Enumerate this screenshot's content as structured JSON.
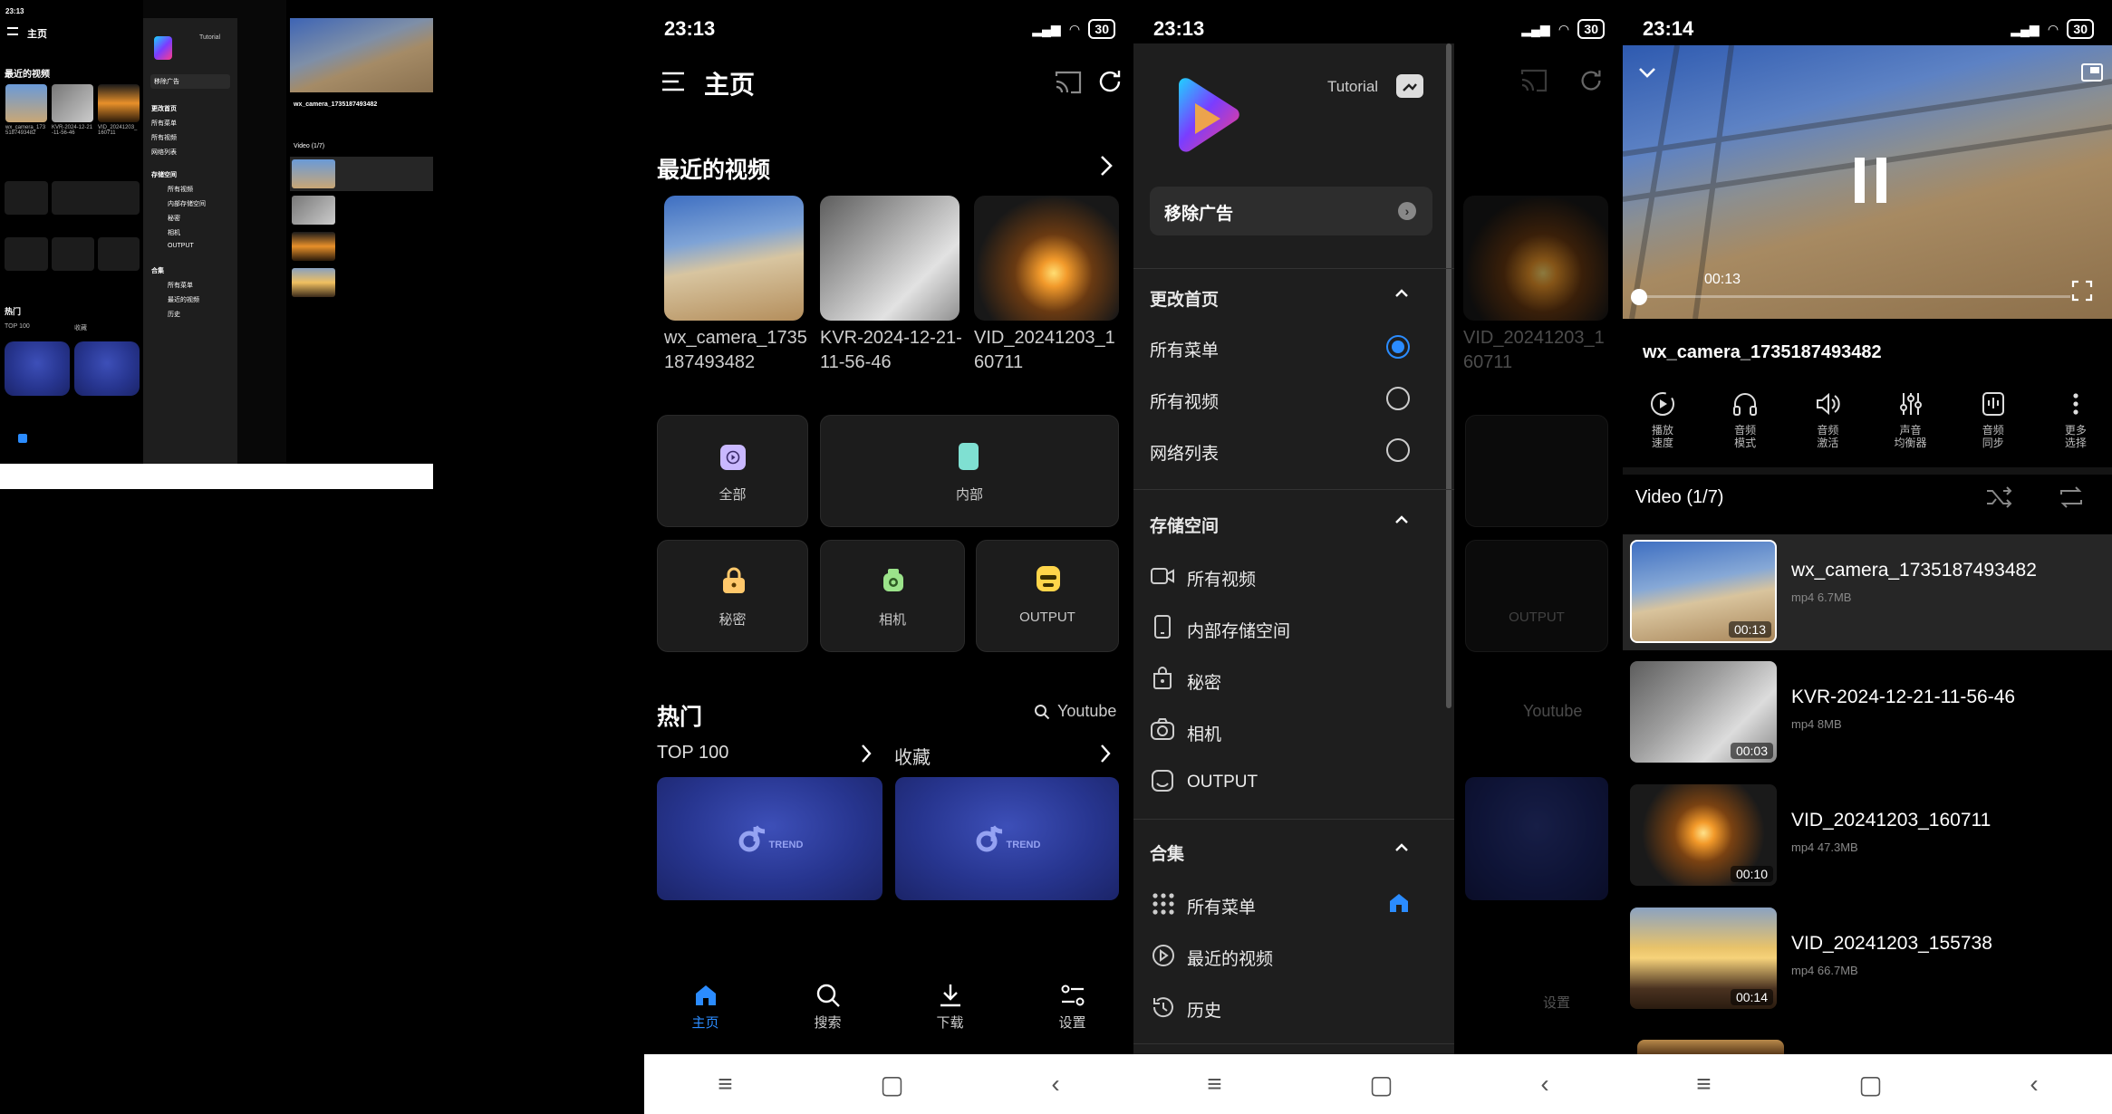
{
  "status": {
    "time_a": "23:13",
    "time_b": "23:13",
    "time_c": "23:14",
    "battery": "30"
  },
  "home": {
    "title": "主页",
    "recent_title": "最近的视频",
    "recent_videos": [
      {
        "name": "wx_camera_1735187493482"
      },
      {
        "name": "KVR-2024-12-21-11-56-46"
      },
      {
        "name": "VID_20241203_160711"
      }
    ],
    "categories": [
      {
        "label": "全部",
        "icon": "play-icon",
        "color": "#c9b8ff"
      },
      {
        "label": "内部",
        "icon": "phone-icon",
        "color": "#7fe0d2"
      },
      {
        "label": "秘密",
        "icon": "lock-icon",
        "color": "#ffc86b"
      },
      {
        "label": "相机",
        "icon": "camera-icon",
        "color": "#9be38a"
      },
      {
        "label": "OUTPUT",
        "icon": "storage-icon",
        "color": "#ffd54a"
      }
    ],
    "hot_title": "热门",
    "youtube_label": "Youtube",
    "top100_label": "TOP 100",
    "favorites_label": "收藏",
    "trend_text": "TREND",
    "bottom_nav": [
      {
        "label": "主页",
        "icon": "home-icon",
        "active": true
      },
      {
        "label": "搜索",
        "icon": "search-icon",
        "active": false
      },
      {
        "label": "下载",
        "icon": "download-icon",
        "active": false
      },
      {
        "label": "设置",
        "icon": "settings-icon",
        "active": false
      }
    ]
  },
  "drawer": {
    "tutorial_label": "Tutorial",
    "remove_ads_label": "移除广告",
    "section_home": "更改首页",
    "home_options": [
      {
        "label": "所有菜单",
        "selected": true
      },
      {
        "label": "所有视频",
        "selected": false
      },
      {
        "label": "网络列表",
        "selected": false
      }
    ],
    "section_storage": "存储空间",
    "storage_items": [
      {
        "label": "所有视频",
        "icon": "video-icon"
      },
      {
        "label": "内部存储空间",
        "icon": "phone-icon"
      },
      {
        "label": "秘密",
        "icon": "lock-icon"
      },
      {
        "label": "相机",
        "icon": "camera-icon"
      },
      {
        "label": "OUTPUT",
        "icon": "storage-icon"
      }
    ],
    "section_collection": "合集",
    "collection_items": [
      {
        "label": "所有菜单",
        "icon": "grid-icon",
        "home": true
      },
      {
        "label": "最近的视频",
        "icon": "play-circle-icon",
        "home": false
      },
      {
        "label": "历史",
        "icon": "history-icon",
        "home": false
      }
    ]
  },
  "player": {
    "elapsed": "00:13",
    "progress_fraction": 0.0,
    "video_title": "wx_camera_1735187493482",
    "controls": [
      {
        "label": "播放\n速度",
        "icon": "speed-icon"
      },
      {
        "label": "音频\n模式",
        "icon": "headphones-icon"
      },
      {
        "label": "音频\n激活",
        "icon": "speaker-icon"
      },
      {
        "label": "声音\n均衡器",
        "icon": "equalizer-icon"
      },
      {
        "label": "音频\n同步",
        "icon": "audio-sync-icon"
      },
      {
        "label": "更多\n选择",
        "icon": "more-icon"
      }
    ],
    "playlist_title": "Video (1/7)",
    "playlist": [
      {
        "name": "wx_camera_1735187493482",
        "meta": "mp4  6.7MB",
        "duration": "00:13",
        "active": true
      },
      {
        "name": "KVR-2024-12-21-11-56-46",
        "meta": "mp4  8MB",
        "duration": "00:03",
        "active": false
      },
      {
        "name": "VID_20241203_160711",
        "meta": "mp4  47.3MB",
        "duration": "00:10",
        "active": false
      },
      {
        "name": "VID_20241203_155738",
        "meta": "mp4  66.7MB",
        "duration": "00:14",
        "active": false
      }
    ]
  },
  "colors": {
    "accent": "#2b8cff",
    "background": "#000000",
    "card": "#1c1c1c",
    "drawer": "#1e1e1e"
  }
}
